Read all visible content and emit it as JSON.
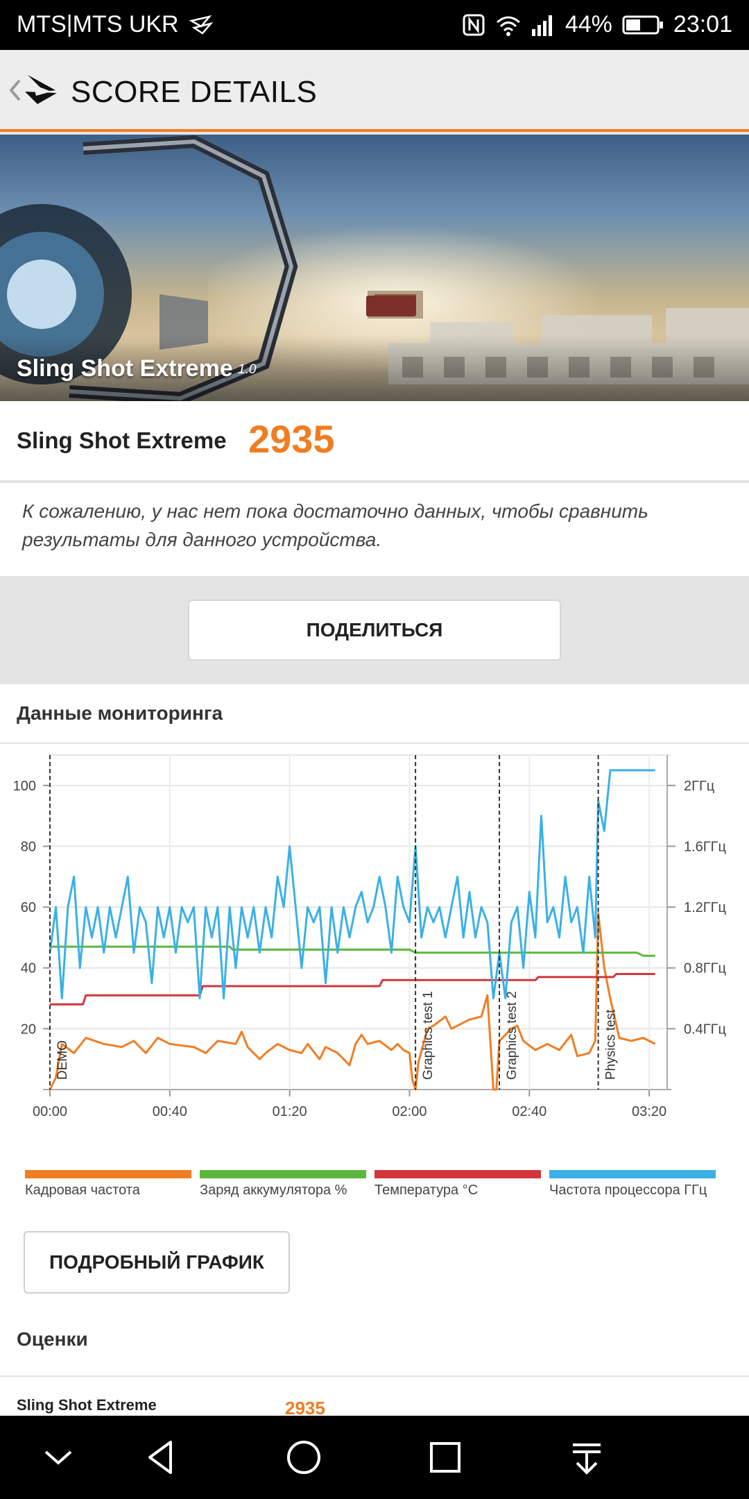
{
  "status_bar": {
    "carrier": "MTS|MTS UKR",
    "battery": "44%",
    "time": "23:01"
  },
  "header": {
    "title": "SCORE DETAILS"
  },
  "banner": {
    "title": "Sling Shot Extreme",
    "version": "1.0"
  },
  "score": {
    "label": "Sling Shot Extreme",
    "value": "2935"
  },
  "note": {
    "text": "К сожалению, у нас нет пока достаточно данных, чтобы сравнить результаты для данного устройства."
  },
  "share_button": {
    "label": "ПОДЕЛИТЬСЯ"
  },
  "monitoring": {
    "title": "Данные мониторинга"
  },
  "detail_button": {
    "label": "ПОДРОБНЫЙ ГРАФИК"
  },
  "scores": {
    "heading": "Оценки",
    "rows": [
      {
        "name": "Sling Shot Extreme",
        "value": "2935"
      }
    ]
  },
  "colors": {
    "accent": "#f07d22",
    "frame_rate": "#f07d22",
    "battery": "#5bb83c",
    "temperature": "#d2363b",
    "cpu": "#3ab0e6"
  },
  "chart_data": {
    "type": "line",
    "x_ticks": [
      "00:00",
      "00:40",
      "01:20",
      "02:00",
      "02:40",
      "03:20"
    ],
    "x_range_seconds": [
      0,
      206
    ],
    "y_left": {
      "ticks": [
        20,
        40,
        60,
        80,
        100
      ],
      "range": [
        0,
        110
      ]
    },
    "y_right": {
      "ticks": [
        "0.4ГГц",
        "0.8ГГц",
        "1.2ГГц",
        "1.6ГГц",
        "2ГГц"
      ],
      "range_ghz": [
        0,
        2.2
      ]
    },
    "phase_markers": [
      {
        "label": "DEMO",
        "t": 0
      },
      {
        "label": "Graphics test 1",
        "t": 122
      },
      {
        "label": "Graphics test 2",
        "t": 150
      },
      {
        "label": "Physics test",
        "t": 183
      }
    ],
    "legend": [
      "Кадровая частота",
      "Заряд аккумулятора %",
      "Температура °C",
      "Частота процессора ГГц"
    ],
    "series": [
      {
        "name": "Кадровая частота",
        "axis": "left",
        "color": "#f07d22",
        "points": [
          [
            0,
            0
          ],
          [
            2,
            4
          ],
          [
            4,
            15
          ],
          [
            8,
            12
          ],
          [
            12,
            17
          ],
          [
            18,
            15
          ],
          [
            24,
            14
          ],
          [
            28,
            16
          ],
          [
            32,
            12
          ],
          [
            36,
            17
          ],
          [
            40,
            15
          ],
          [
            48,
            14
          ],
          [
            52,
            12
          ],
          [
            56,
            16
          ],
          [
            62,
            15
          ],
          [
            64,
            19
          ],
          [
            66,
            14
          ],
          [
            70,
            10
          ],
          [
            72,
            12
          ],
          [
            76,
            15
          ],
          [
            80,
            13
          ],
          [
            84,
            12
          ],
          [
            86,
            15
          ],
          [
            90,
            10
          ],
          [
            92,
            14
          ],
          [
            96,
            12
          ],
          [
            100,
            8
          ],
          [
            102,
            15
          ],
          [
            104,
            18
          ],
          [
            106,
            15
          ],
          [
            110,
            16
          ],
          [
            114,
            13
          ],
          [
            116,
            15
          ],
          [
            118,
            13
          ],
          [
            120,
            12
          ],
          [
            121,
            3
          ],
          [
            122,
            0
          ],
          [
            123,
            9
          ],
          [
            126,
            20
          ],
          [
            128,
            21
          ],
          [
            132,
            24
          ],
          [
            134,
            20
          ],
          [
            138,
            22
          ],
          [
            140,
            23
          ],
          [
            144,
            24
          ],
          [
            146,
            31
          ],
          [
            148,
            0
          ],
          [
            149,
            0
          ],
          [
            150,
            16
          ],
          [
            154,
            20
          ],
          [
            156,
            21
          ],
          [
            158,
            16
          ],
          [
            162,
            13
          ],
          [
            166,
            15
          ],
          [
            170,
            13
          ],
          [
            174,
            18
          ],
          [
            176,
            11
          ],
          [
            180,
            12
          ],
          [
            182,
            16
          ],
          [
            183,
            58
          ],
          [
            185,
            40
          ],
          [
            187,
            30
          ],
          [
            190,
            17
          ],
          [
            194,
            16
          ],
          [
            198,
            17
          ],
          [
            202,
            15
          ]
        ]
      },
      {
        "name": "Заряд аккумулятора %",
        "axis": "left",
        "color": "#5bb83c",
        "points": [
          [
            0,
            47
          ],
          [
            60,
            47
          ],
          [
            61,
            46
          ],
          [
            120,
            46
          ],
          [
            122,
            45
          ],
          [
            196,
            45
          ],
          [
            198,
            44
          ],
          [
            202,
            44
          ]
        ]
      },
      {
        "name": "Температура °C",
        "axis": "left",
        "color": "#d2363b",
        "points": [
          [
            0,
            28
          ],
          [
            11,
            28
          ],
          [
            12,
            31
          ],
          [
            50,
            31
          ],
          [
            51,
            34
          ],
          [
            110,
            34
          ],
          [
            111,
            36
          ],
          [
            162,
            36
          ],
          [
            163,
            37
          ],
          [
            188,
            37
          ],
          [
            189,
            38
          ],
          [
            202,
            38
          ]
        ]
      },
      {
        "name": "Частота процессора ГГц",
        "axis": "right",
        "color": "#3ab0e6",
        "points": [
          [
            0,
            0.9
          ],
          [
            2,
            1.2
          ],
          [
            4,
            0.6
          ],
          [
            6,
            1.2
          ],
          [
            8,
            1.4
          ],
          [
            10,
            0.8
          ],
          [
            12,
            1.2
          ],
          [
            14,
            1.0
          ],
          [
            16,
            1.2
          ],
          [
            18,
            0.9
          ],
          [
            20,
            1.2
          ],
          [
            22,
            1.0
          ],
          [
            24,
            1.2
          ],
          [
            26,
            1.4
          ],
          [
            28,
            0.9
          ],
          [
            30,
            1.2
          ],
          [
            32,
            1.1
          ],
          [
            34,
            0.7
          ],
          [
            36,
            1.2
          ],
          [
            38,
            1.0
          ],
          [
            40,
            1.2
          ],
          [
            42,
            0.9
          ],
          [
            44,
            1.2
          ],
          [
            46,
            1.1
          ],
          [
            48,
            1.2
          ],
          [
            50,
            0.6
          ],
          [
            52,
            1.2
          ],
          [
            54,
            1.0
          ],
          [
            56,
            1.2
          ],
          [
            58,
            0.6
          ],
          [
            60,
            1.2
          ],
          [
            62,
            0.8
          ],
          [
            64,
            1.2
          ],
          [
            66,
            1.0
          ],
          [
            68,
            1.2
          ],
          [
            70,
            0.9
          ],
          [
            72,
            1.2
          ],
          [
            74,
            1.0
          ],
          [
            76,
            1.4
          ],
          [
            78,
            1.2
          ],
          [
            80,
            1.6
          ],
          [
            82,
            1.2
          ],
          [
            84,
            0.8
          ],
          [
            86,
            1.2
          ],
          [
            88,
            1.1
          ],
          [
            90,
            1.2
          ],
          [
            92,
            0.7
          ],
          [
            94,
            1.2
          ],
          [
            96,
            0.9
          ],
          [
            98,
            1.2
          ],
          [
            100,
            1.0
          ],
          [
            102,
            1.2
          ],
          [
            104,
            1.3
          ],
          [
            106,
            1.1
          ],
          [
            108,
            1.2
          ],
          [
            110,
            1.4
          ],
          [
            112,
            1.2
          ],
          [
            114,
            0.9
          ],
          [
            116,
            1.4
          ],
          [
            118,
            1.2
          ],
          [
            120,
            1.1
          ],
          [
            122,
            1.6
          ],
          [
            124,
            1.0
          ],
          [
            126,
            1.2
          ],
          [
            128,
            1.1
          ],
          [
            130,
            1.2
          ],
          [
            132,
            1.0
          ],
          [
            134,
            1.2
          ],
          [
            136,
            1.4
          ],
          [
            138,
            1.0
          ],
          [
            140,
            1.3
          ],
          [
            142,
            1.0
          ],
          [
            144,
            1.2
          ],
          [
            146,
            1.1
          ],
          [
            148,
            0.6
          ],
          [
            150,
            0.9
          ],
          [
            152,
            0.6
          ],
          [
            154,
            1.1
          ],
          [
            156,
            1.2
          ],
          [
            158,
            0.8
          ],
          [
            160,
            1.3
          ],
          [
            162,
            1.0
          ],
          [
            164,
            1.8
          ],
          [
            166,
            1.1
          ],
          [
            168,
            1.2
          ],
          [
            170,
            1.0
          ],
          [
            172,
            1.4
          ],
          [
            174,
            1.1
          ],
          [
            176,
            1.2
          ],
          [
            178,
            0.9
          ],
          [
            180,
            1.4
          ],
          [
            182,
            1.0
          ],
          [
            183,
            1.9
          ],
          [
            185,
            1.7
          ],
          [
            187,
            2.1
          ],
          [
            190,
            2.1
          ],
          [
            196,
            2.1
          ],
          [
            202,
            2.1
          ]
        ]
      }
    ]
  }
}
